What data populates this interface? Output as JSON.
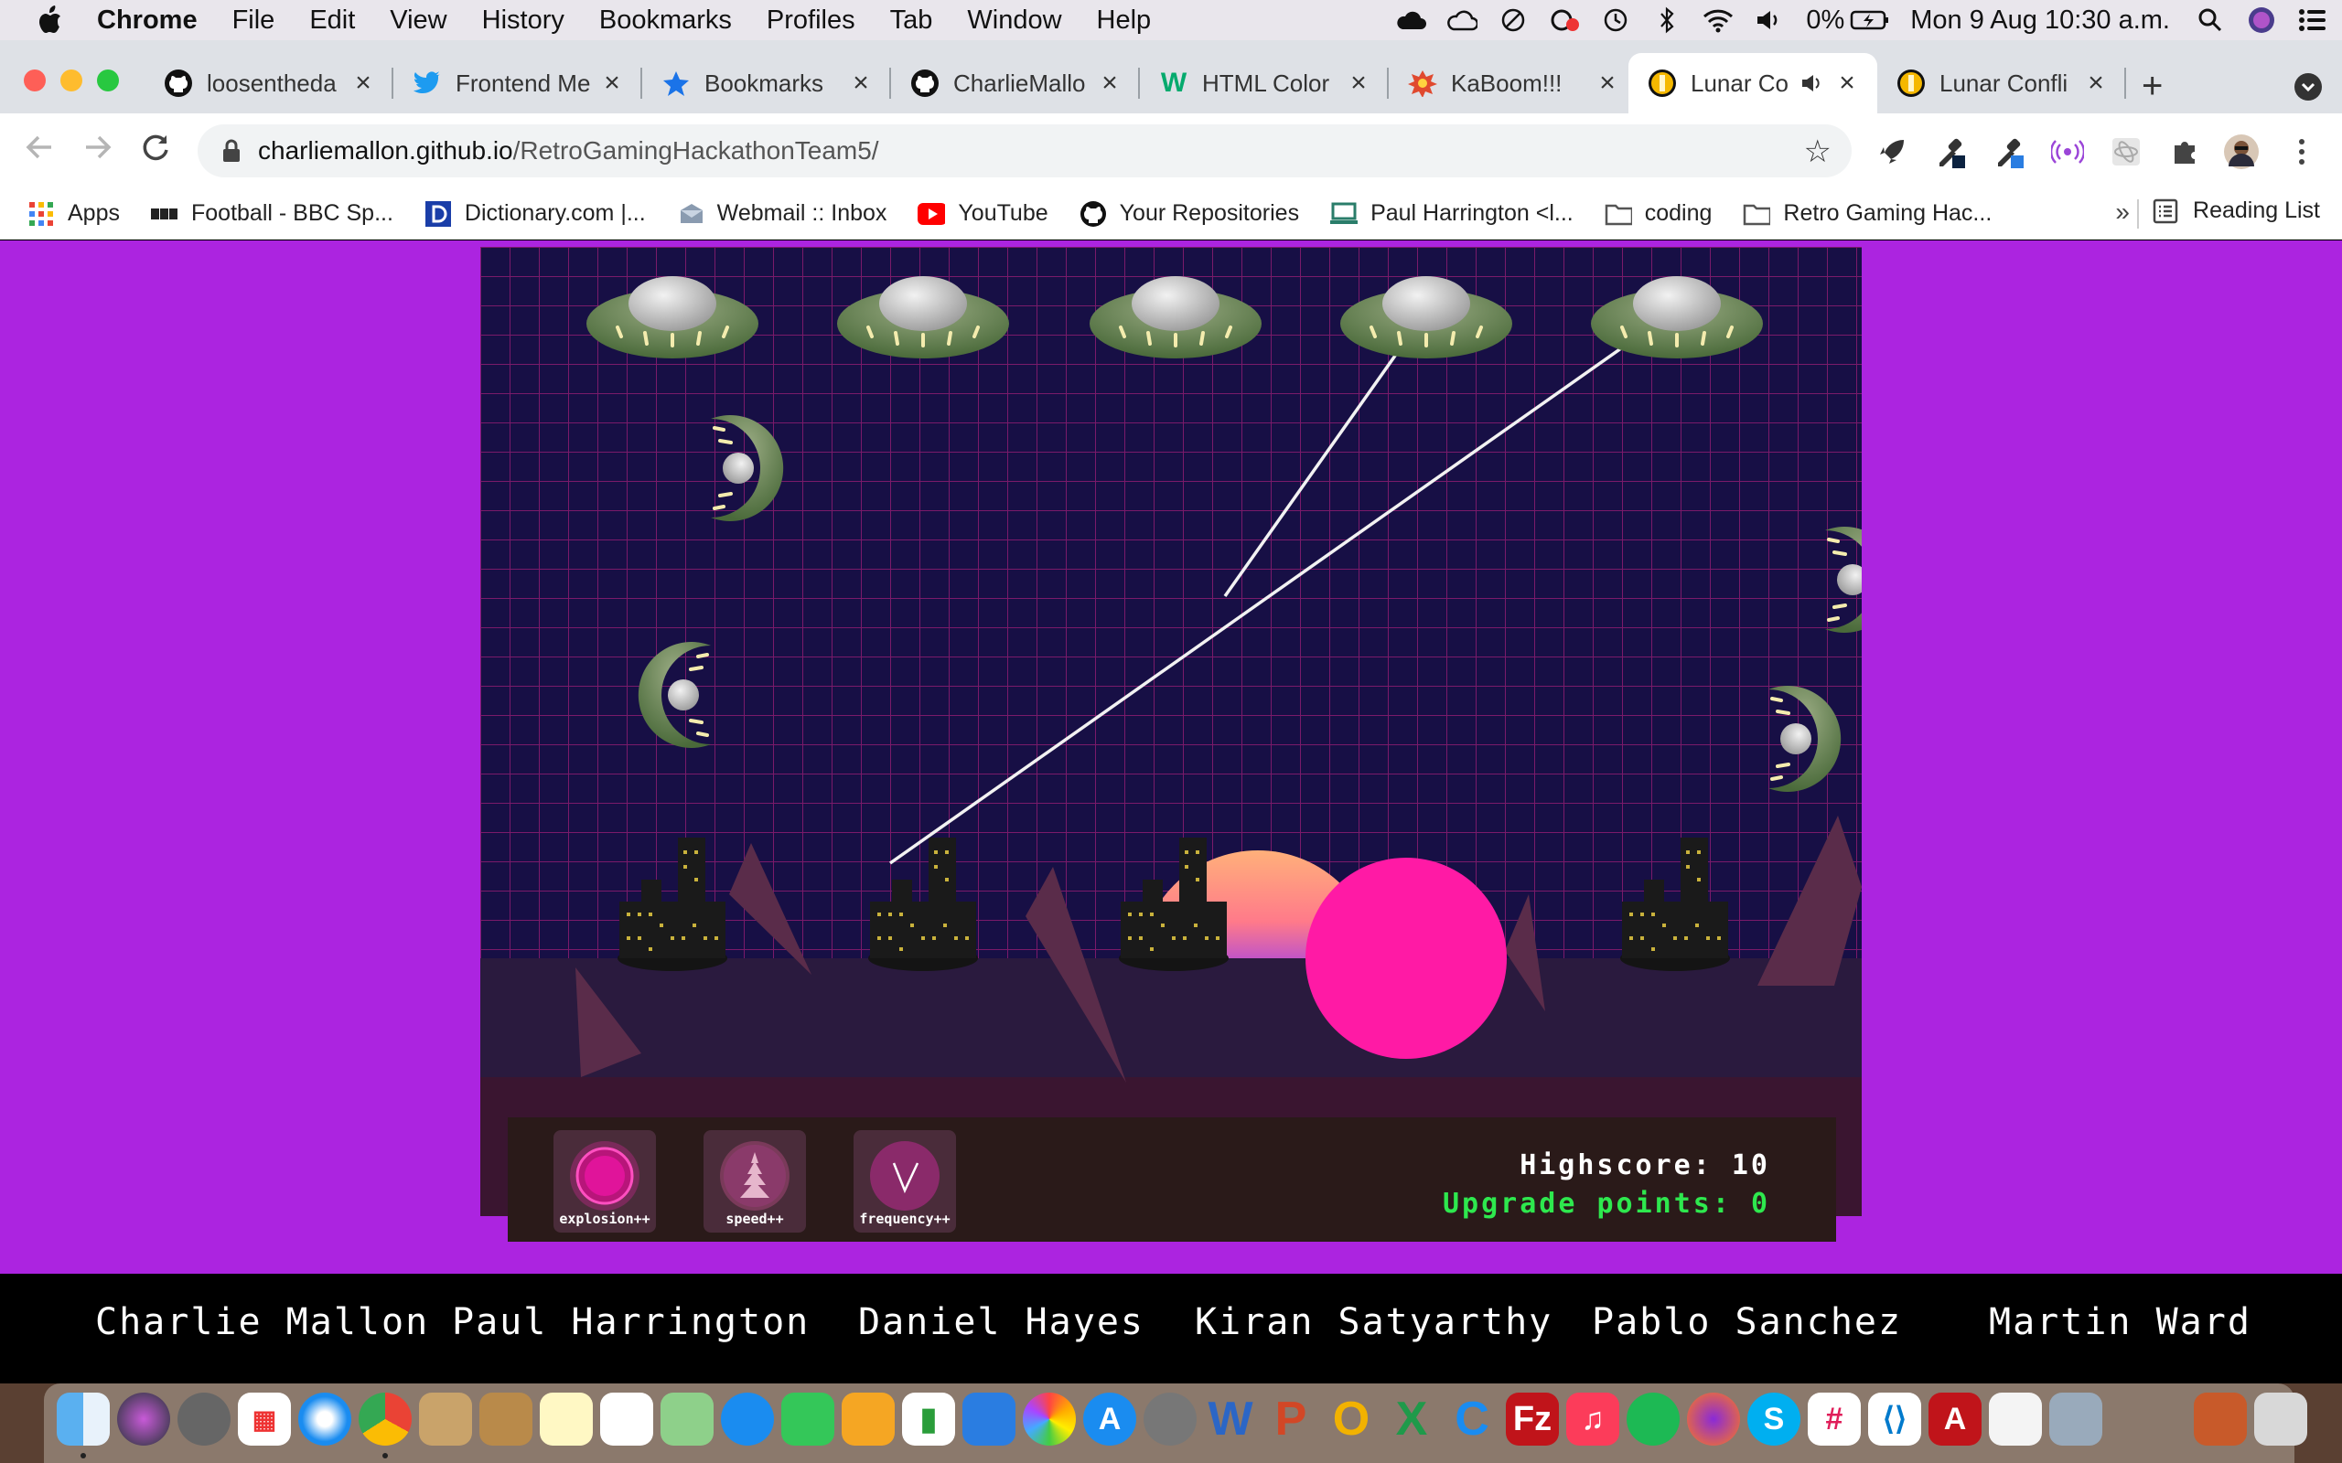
{
  "menubar": {
    "app_name": "Chrome",
    "items": [
      "File",
      "Edit",
      "View",
      "History",
      "Bookmarks",
      "Profiles",
      "Tab",
      "Window",
      "Help"
    ],
    "battery_text": "0%",
    "datetime": "Mon 9 Aug  10:30 a.m."
  },
  "tabs": [
    {
      "label": "loosentheda",
      "icon": "github-icon"
    },
    {
      "label": "Frontend Me",
      "icon": "twitter-icon"
    },
    {
      "label": "Bookmarks",
      "icon": "star-icon"
    },
    {
      "label": "CharlieMallo",
      "icon": "github-icon"
    },
    {
      "label": "HTML Color",
      "icon": "w3-icon"
    },
    {
      "label": "KaBoom!!!",
      "icon": "kaboom-icon"
    },
    {
      "label": "Lunar Co",
      "icon": "coin-icon",
      "active": true
    },
    {
      "label": "Lunar Confli",
      "icon": "coin-icon"
    }
  ],
  "omnibox": {
    "host": "charliemallon.github.io",
    "path": "/RetroGamingHackathonTeam5/"
  },
  "bookmarks": [
    {
      "label": "Apps",
      "icon": "apps-grid-icon"
    },
    {
      "label": "Football - BBC Sp...",
      "icon": "bbc-icon"
    },
    {
      "label": "Dictionary.com |...",
      "icon": "dictionary-icon"
    },
    {
      "label": "Webmail :: Inbox",
      "icon": "webmail-icon"
    },
    {
      "label": "YouTube",
      "icon": "youtube-icon"
    },
    {
      "label": "Your Repositories",
      "icon": "github-icon"
    },
    {
      "label": "Paul Harrington <l...",
      "icon": "laptop-icon"
    },
    {
      "label": "coding",
      "icon": "folder-icon"
    },
    {
      "label": "Retro Gaming Hac...",
      "icon": "folder-icon"
    }
  ],
  "bookmarks_more": "»",
  "reading_list": "Reading List",
  "game": {
    "upgrades": [
      {
        "label": "explosion++",
        "icon": "explosion-icon"
      },
      {
        "label": "speed++",
        "icon": "speed-icon"
      },
      {
        "label": "frequency++",
        "icon": "frequency-icon"
      }
    ],
    "highscore_label": "Highscore: 10",
    "upgrade_points_label": "Upgrade points: 0"
  },
  "credits": [
    "Charlie Mallon",
    "Paul Harrington",
    "Daniel Hayes",
    "Kiran Satyarthy",
    "Pablo Sanchez",
    "Martin Ward"
  ],
  "colors": {
    "page_bg": "#ac24e0",
    "game_sky": "#170f45",
    "grid": "#7a1a6a",
    "explosion": "#ff1aa5",
    "ground": "#2a1a3e"
  }
}
